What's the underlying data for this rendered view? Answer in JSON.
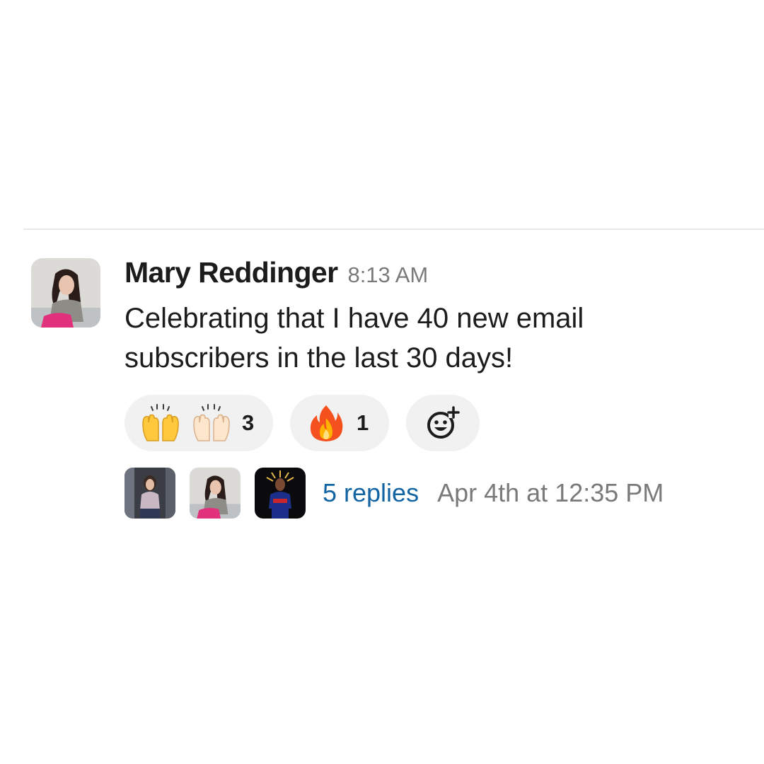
{
  "message": {
    "author": "Mary Reddinger",
    "time": "8:13 AM",
    "text": "Celebrating that I have 40 new email subscribers in the last 30 days!"
  },
  "reactions": [
    {
      "emoji": [
        "raising-hands",
        "raising-hands-light"
      ],
      "count": "3"
    },
    {
      "emoji": [
        "fire"
      ],
      "count": "1"
    }
  ],
  "add_reaction_icon": "add-reaction-icon",
  "thread": {
    "participants": [
      "participant-1",
      "participant-2",
      "participant-3"
    ],
    "replies_label": "5 replies",
    "last_reply": "Apr 4th at 12:35 PM"
  },
  "colors": {
    "link": "#1264a3",
    "muted": "#7a7a7a",
    "text": "#1d1c1d",
    "pill_bg": "#f1f1f1"
  }
}
